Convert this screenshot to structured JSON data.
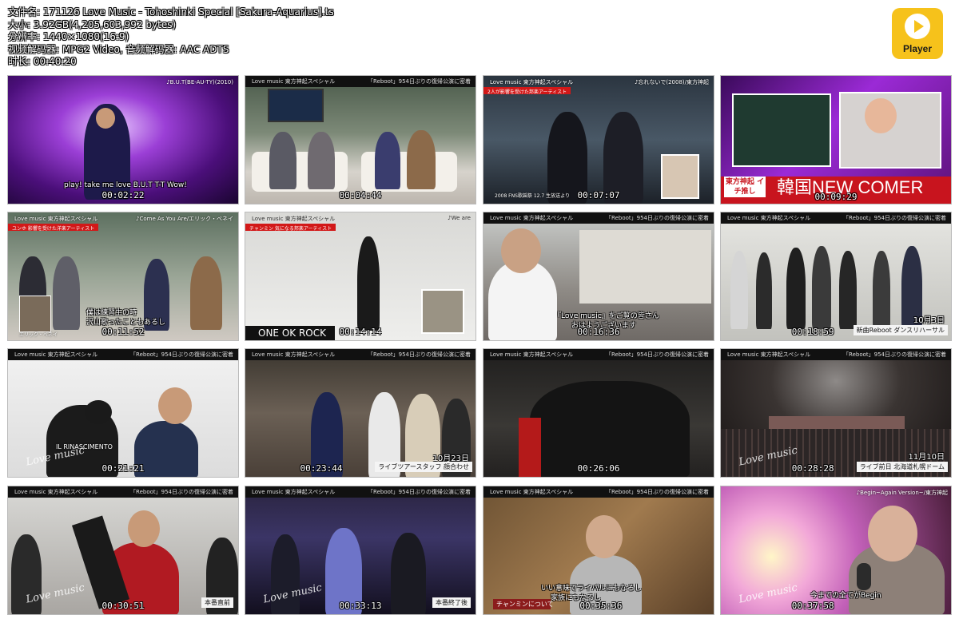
{
  "header": {
    "lines": [
      "文件名: 171126 Love Music - Tohoshinki Special [Sakura-Aquarius].ts",
      "大小: 3.92GB(4,205,603,992 bytes)",
      "分辨率: 1440×1080(16:9)",
      "视频解码器: MPG2 Video, 音频解码器: AAC ADTS",
      "时长: 00:40:20"
    ]
  },
  "player": {
    "label": "Player",
    "icon": "play-icon"
  },
  "topbar_left": "Love music  東方神起スペシャル",
  "topbar_right": "「Reboot」954日ぶりの復帰公演に密着",
  "thumbs": [
    {
      "time": "00:02:22",
      "right": "♪B.U.T(BE-AU-TY)(2010)",
      "sub": "play! take me love B.U.T T-T Wow!"
    },
    {
      "time": "00:04:44",
      "right": "「Reboot」954日ぶりの復帰公演に密着"
    },
    {
      "time": "00:07:07",
      "left": "2人が影響を受けた邦楽アーティスト",
      "right": "♪忘れないで(2008)/東方神起",
      "caption": "2008 FNS歌謡祭 12.7 生放送より"
    },
    {
      "time": "00:09:29",
      "title": "韓国NEW COMER",
      "pill": "東方神起 イチ推し"
    },
    {
      "time": "00:11:52",
      "left": "ユンホ 影響を受けた洋楽アーティスト",
      "right": "♪Come As You Are/エリック・ベネイ",
      "sub1": "僕は練習生の時",
      "sub2": "沢山歌ったこともあるし",
      "name": "エリック・ベネイ"
    },
    {
      "time": "00:14:14",
      "left": "チャンミン 気になる邦楽アーティスト",
      "right": "♪We are",
      "band": "ONE OK ROCK"
    },
    {
      "time": "00:16:36",
      "sub1": "『Love music』をご覧の皆さん",
      "sub2": "おはようございます"
    },
    {
      "time": "00:18:59",
      "date": "10月3日",
      "tag": "新曲Reboot ダンスリハーサル"
    },
    {
      "time": "00:21:21",
      "shirt": "IL RINASCIMENTO"
    },
    {
      "time": "00:23:44",
      "date": "10月23日",
      "tag": "ライブツアースタッフ 顔合わせ"
    },
    {
      "time": "00:26:06"
    },
    {
      "time": "00:28:28",
      "date": "11月10日",
      "tag": "ライブ前日 北海道札幌ドーム"
    },
    {
      "time": "00:30:51",
      "tag": "本番直前"
    },
    {
      "time": "00:33:13",
      "tag": "本番終了後"
    },
    {
      "time": "00:35:36",
      "sub1": "いい意味でライバルにもなるし",
      "sub2": "家族にもなるし",
      "label": "チャンミンについて"
    },
    {
      "time": "00:37:58",
      "right": "♪Begin~Again Version~/東方神起",
      "sub": "今までの全てがBegin"
    }
  ],
  "watermark": "Love music",
  "colors": {
    "accent": "#f6c21b",
    "red": "#d21818",
    "purple": "#7a1fa8"
  }
}
